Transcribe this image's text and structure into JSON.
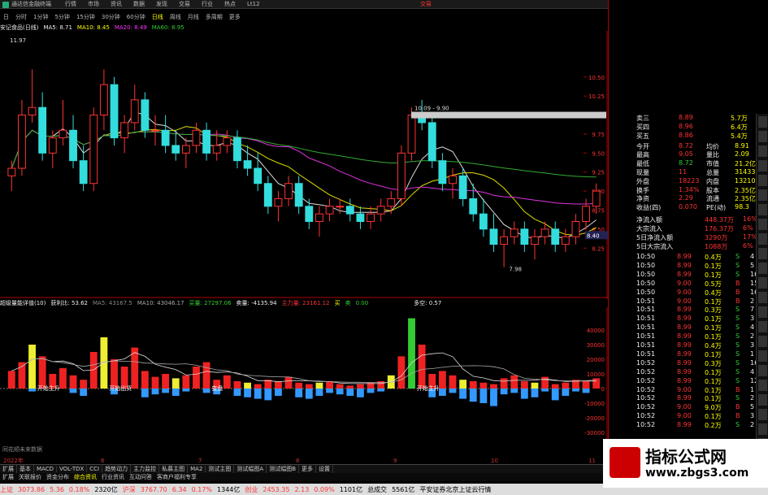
{
  "titlebar": {
    "app": "通达信金融终端",
    "menu": [
      "行情",
      "市场",
      "资讯",
      "数据",
      "发现",
      "交易",
      "行业",
      "热点",
      "Lt12"
    ],
    "right": "交易"
  },
  "periods": [
    {
      "label": "日"
    },
    {
      "label": "分时"
    },
    {
      "label": "1分钟"
    },
    {
      "label": "5分钟"
    },
    {
      "label": "15分钟"
    },
    {
      "label": "30分钟"
    },
    {
      "label": "60分钟"
    },
    {
      "label": "日线",
      "active": true
    },
    {
      "label": "周线"
    },
    {
      "label": "月线"
    },
    {
      "label": "多周期"
    },
    {
      "label": "更多"
    }
  ],
  "ma": {
    "name": "安记食品(日线)",
    "ma5": "MA5: 8.71",
    "ma10": "MA10: 8.45",
    "ma20": "MA20: 8.49",
    "ma60": "MA60: 8.95"
  },
  "price_labels": {
    "high": "11.97",
    "mid": "10.09 - 9.90",
    "low": "7.98",
    "cur": "8.40"
  },
  "price_axis": [
    "10.50",
    "10.25",
    "10.00",
    "9.75",
    "9.50",
    "9.25",
    "9.00",
    "8.75",
    "8.50",
    "8.25"
  ],
  "sub": {
    "name": "超级量能详值(10)",
    "ratio": "获利比: 53.62",
    "ma5": "MA5: 43167.5",
    "ma10": "MA10: 43046.17",
    "buy": "买量: 27297.06",
    "sell": "卖量: -4135.94",
    "main": "主力量: 23161.12",
    "ind1": "买",
    "ind2": "卖",
    "ind3": "0.00",
    "ind4": "多空: 0.57"
  },
  "vol_axis": [
    "40000",
    "30000",
    "20000",
    "10000",
    "0",
    "-10000",
    "-20000",
    "-30000"
  ],
  "vol_labels": [
    "开始主升",
    "开始出货",
    "变盘",
    "开始主升"
  ],
  "stock_label": "同花顺未来数据",
  "x_axis": [
    "2022年",
    "6",
    "7",
    "8",
    "9",
    "10",
    "11"
  ],
  "tabs": [
    "扩展",
    "基本",
    "MACD",
    "VOL-TDX",
    "CCI",
    "趋势动力",
    "主力监控",
    "私募主图",
    "MA2",
    "测试主图",
    "测试幅图A",
    "测试幅图B",
    "更多",
    "设置"
  ],
  "tabs2": [
    {
      "label": "扩展"
    },
    {
      "label": "关联报价"
    },
    {
      "label": "资金分布"
    },
    {
      "label": "综合资讯",
      "active": true
    },
    {
      "label": "行业资讯"
    },
    {
      "label": "互动问答"
    },
    {
      "label": "客商户福利专享"
    }
  ],
  "status": {
    "sh_name": "上证",
    "sh_val": "3073.86",
    "sh_chg": "5.36",
    "sh_pct": "0.18%",
    "sh_amt": "2320亿",
    "sz_name": "沪深",
    "sz_val": "3767.70",
    "sz_chg": "6.34",
    "sz_pct": "0.17%",
    "sz_amt": "1344亿",
    "cy_name": "创业",
    "cy_val": "2453.35",
    "cy_chg": "2.13",
    "cy_pct": "0.09%",
    "cy_amt": "1101亿",
    "tot_name": "总成交",
    "tot_amt": "5561亿",
    "broker": "平安证券北京上证云行情"
  },
  "quote": [
    {
      "l": "卖三",
      "v": "8.89",
      "n": "5.7万"
    },
    {
      "l": "买四",
      "v": "8.96",
      "n": "6.4万"
    },
    {
      "l": "买五",
      "v": "8.86",
      "n": "5.4万"
    },
    {
      "l": "今开",
      "v": "8.72",
      "l2": "均价",
      "v2": "8.91"
    },
    {
      "l": "最高",
      "v": "9.05",
      "l2": "量比",
      "v2": "2.09"
    },
    {
      "l": "最低",
      "v": "8.72",
      "l2": "市值",
      "v2": "21.2亿"
    },
    {
      "l": "现量",
      "v": "11",
      "l2": "总量",
      "v2": "31433"
    },
    {
      "l": "外盘",
      "v": "18223",
      "l2": "内盘",
      "v2": "13210"
    },
    {
      "l": "换手",
      "v": "1.34%",
      "l2": "股本",
      "v2": "2.35亿"
    },
    {
      "l": "净资",
      "v": "2.29",
      "l2": "流通",
      "v2": "2.35亿"
    },
    {
      "l": "收益(四)",
      "v": "0.070",
      "l2": "PE(动)",
      "v2": "98.3"
    }
  ],
  "flow": [
    {
      "l": "净流入额",
      "v": "448.37万",
      "p": "16%"
    },
    {
      "l": "大宗流入",
      "v": "176.37万",
      "p": "6%"
    },
    {
      "l": "5日净流入额",
      "v": "3290万",
      "p": "17%"
    },
    {
      "l": "5日大宗流入",
      "v": "1088万",
      "p": "6%"
    }
  ],
  "ticks": [
    {
      "t": "10:50",
      "p": "8.99",
      "v": "0.4万",
      "s": "S",
      "c": "4"
    },
    {
      "t": "10:50",
      "p": "8.99",
      "v": "0.1万",
      "s": "S",
      "c": "5"
    },
    {
      "t": "10:50",
      "p": "8.99",
      "v": "0.1万",
      "s": "S",
      "c": "16"
    },
    {
      "t": "10:50",
      "p": "9.00",
      "v": "0.5万",
      "s": "B",
      "c": "15"
    },
    {
      "t": "10:50",
      "p": "9.00",
      "v": "0.4万",
      "s": "B",
      "c": "16"
    },
    {
      "t": "10:51",
      "p": "9.00",
      "v": "0.1万",
      "s": "B",
      "c": "2"
    },
    {
      "t": "10:51",
      "p": "8.99",
      "v": "0.3万",
      "s": "S",
      "c": "7"
    },
    {
      "t": "10:51",
      "p": "8.99",
      "v": "0.1万",
      "s": "S",
      "c": "3"
    },
    {
      "t": "10:51",
      "p": "8.99",
      "v": "0.1万",
      "s": "S",
      "c": "4"
    },
    {
      "t": "10:51",
      "p": "8.99",
      "v": "0.1万",
      "s": "S",
      "c": "2"
    },
    {
      "t": "10:51",
      "p": "8.99",
      "v": "0.4万",
      "s": "S",
      "c": "3"
    },
    {
      "t": "10:51",
      "p": "8.99",
      "v": "0.1万",
      "s": "S",
      "c": "1"
    },
    {
      "t": "10:52",
      "p": "8.99",
      "v": "0.3万",
      "s": "S",
      "c": "16"
    },
    {
      "t": "10:52",
      "p": "8.99",
      "v": "0.1万",
      "s": "S",
      "c": "4"
    },
    {
      "t": "10:52",
      "p": "8.99",
      "v": "0.1万",
      "s": "S",
      "c": "12"
    },
    {
      "t": "10:52",
      "p": "9.00",
      "v": "0.1万",
      "s": "B",
      "c": "1"
    },
    {
      "t": "10:52",
      "p": "8.99",
      "v": "0.1万",
      "s": "S",
      "c": "2"
    },
    {
      "t": "10:52",
      "p": "9.00",
      "v": "9.0万",
      "s": "B",
      "c": "5"
    },
    {
      "t": "10:52",
      "p": "9.00",
      "v": "0.1万",
      "s": "B",
      "c": "3"
    },
    {
      "t": "10:52",
      "p": "8.99",
      "v": "0.2万",
      "s": "S",
      "c": "2"
    }
  ],
  "watermark": {
    "line1": "指标公式网",
    "line2": "www.zbgs3.com"
  },
  "chart_data": {
    "type": "candlestick",
    "ylim": [
      7.9,
      11.0
    ],
    "candles": [
      [
        9.2,
        9.4,
        9.0,
        9.3
      ],
      [
        9.3,
        10.2,
        9.2,
        10.0
      ],
      [
        10.0,
        10.6,
        9.9,
        10.1
      ],
      [
        10.1,
        10.3,
        9.4,
        9.5
      ],
      [
        9.5,
        9.8,
        9.3,
        9.7
      ],
      [
        9.7,
        10.2,
        9.6,
        9.8
      ],
      [
        9.8,
        10.0,
        9.3,
        9.4
      ],
      [
        9.4,
        9.6,
        9.0,
        9.1
      ],
      [
        9.1,
        10.1,
        9.0,
        10.0
      ],
      [
        10.0,
        10.6,
        9.8,
        10.4
      ],
      [
        10.4,
        10.5,
        9.6,
        9.7
      ],
      [
        9.7,
        10.0,
        9.5,
        9.9
      ],
      [
        9.9,
        10.4,
        9.8,
        10.2
      ],
      [
        10.2,
        10.3,
        9.7,
        9.8
      ],
      [
        9.8,
        10.0,
        9.6,
        9.8
      ],
      [
        9.8,
        10.0,
        9.5,
        9.6
      ],
      [
        9.6,
        9.8,
        9.4,
        9.5
      ],
      [
        9.5,
        9.7,
        9.3,
        9.6
      ],
      [
        9.6,
        9.9,
        9.5,
        9.8
      ],
      [
        9.8,
        9.9,
        9.4,
        9.5
      ],
      [
        9.5,
        9.8,
        9.4,
        9.6
      ],
      [
        9.6,
        9.8,
        9.5,
        9.7
      ],
      [
        9.7,
        9.8,
        9.3,
        9.4
      ],
      [
        9.4,
        9.6,
        9.2,
        9.3
      ],
      [
        9.3,
        9.5,
        9.0,
        9.1
      ],
      [
        9.1,
        9.2,
        8.7,
        8.8
      ],
      [
        8.8,
        9.0,
        8.6,
        8.9
      ],
      [
        8.9,
        9.2,
        8.8,
        9.1
      ],
      [
        9.1,
        9.2,
        8.7,
        8.8
      ],
      [
        8.8,
        8.9,
        8.5,
        8.6
      ],
      [
        8.6,
        8.8,
        8.4,
        8.7
      ],
      [
        8.7,
        8.9,
        8.6,
        8.8
      ],
      [
        8.8,
        8.9,
        8.7,
        8.8
      ],
      [
        8.8,
        8.9,
        8.6,
        8.7
      ],
      [
        8.7,
        8.8,
        8.5,
        8.6
      ],
      [
        8.6,
        8.8,
        8.5,
        8.7
      ],
      [
        8.7,
        8.9,
        8.6,
        8.8
      ],
      [
        8.8,
        9.0,
        8.7,
        8.9
      ],
      [
        8.9,
        9.6,
        8.8,
        9.5
      ],
      [
        9.5,
        10.1,
        9.4,
        10.0
      ],
      [
        10.0,
        10.2,
        9.8,
        9.9
      ],
      [
        9.9,
        10.0,
        9.3,
        9.4
      ],
      [
        9.4,
        9.5,
        9.0,
        9.1
      ],
      [
        9.1,
        9.3,
        8.9,
        9.2
      ],
      [
        9.2,
        9.3,
        8.8,
        8.9
      ],
      [
        8.9,
        9.1,
        8.6,
        8.7
      ],
      [
        8.7,
        8.9,
        8.4,
        8.5
      ],
      [
        8.5,
        8.7,
        8.2,
        8.3
      ],
      [
        8.3,
        8.5,
        8.0,
        8.4
      ],
      [
        8.4,
        8.6,
        8.3,
        8.5
      ],
      [
        8.5,
        8.6,
        8.2,
        8.3
      ],
      [
        8.3,
        8.5,
        8.1,
        8.4
      ],
      [
        8.4,
        8.6,
        8.3,
        8.5
      ],
      [
        8.5,
        8.6,
        8.2,
        8.3
      ],
      [
        8.3,
        8.5,
        8.2,
        8.4
      ],
      [
        8.4,
        8.7,
        8.3,
        8.6
      ],
      [
        8.6,
        8.9,
        8.5,
        8.8
      ],
      [
        8.8,
        9.1,
        8.7,
        9.0
      ]
    ],
    "volumes": [
      12000,
      18000,
      30000,
      22000,
      10000,
      14000,
      9000,
      6000,
      25000,
      35000,
      20000,
      15000,
      28000,
      12000,
      8000,
      10000,
      7000,
      9000,
      15000,
      18000,
      6000,
      9000,
      5000,
      4000,
      3000,
      6000,
      5000,
      8000,
      4000,
      3000,
      4000,
      5000,
      3000,
      2000,
      3000,
      4000,
      5000,
      9000,
      22000,
      48000,
      30000,
      10000,
      12000,
      9000,
      6000,
      5000,
      4000,
      3000,
      7000,
      9000,
      5000,
      4000,
      8000,
      3000,
      4000,
      6000,
      5000,
      7000
    ],
    "neg_volumes": [
      0,
      0,
      2000,
      0,
      0,
      0,
      3000,
      5000,
      0,
      0,
      4000,
      0,
      0,
      6000,
      4000,
      3000,
      5000,
      2000,
      0,
      3000,
      4000,
      0,
      5000,
      6000,
      7000,
      8000,
      5000,
      0,
      6000,
      7000,
      5000,
      3000,
      4000,
      5000,
      6000,
      3000,
      2000,
      0,
      0,
      0,
      0,
      6000,
      5000,
      3000,
      7000,
      9000,
      10000,
      12000,
      4000,
      3000,
      7000,
      6000,
      2000,
      8000,
      5000,
      2000,
      3000,
      0
    ]
  }
}
